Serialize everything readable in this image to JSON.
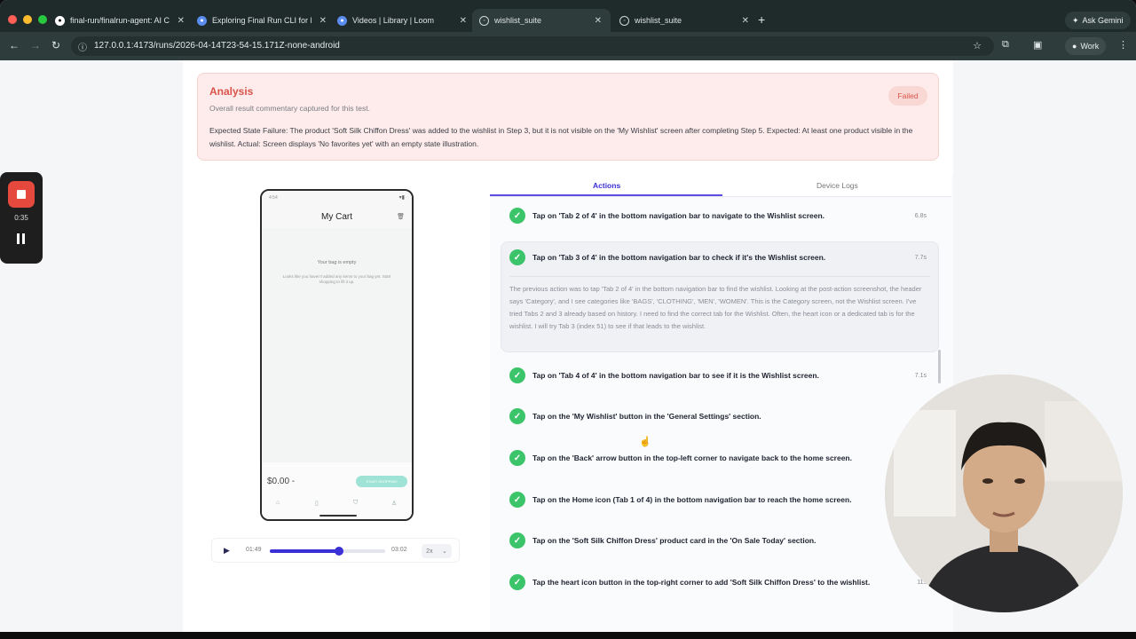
{
  "browser": {
    "tabs": [
      {
        "label": "final-run/finalrun-agent: AI C",
        "icon": "github-icon"
      },
      {
        "label": "Exploring Final Run CLI for E",
        "icon": "chrome-icon"
      },
      {
        "label": "Videos | Library | Loom",
        "icon": "chrome-icon"
      },
      {
        "label": "wishlist_suite",
        "icon": "globe-icon",
        "active": true
      },
      {
        "label": "wishlist_suite",
        "icon": "globe-icon"
      }
    ],
    "ask_gemini": "Ask Gemini",
    "url": "127.0.0.1:4173/runs/2026-04-14T23-54-15.171Z-none-android",
    "profile": "Work",
    "colors": {
      "chrome": "#1f2a2a",
      "toolbar": "#2f3c3c"
    }
  },
  "analysis": {
    "title": "Analysis",
    "subtitle": "Overall result commentary captured for this test.",
    "status": "Failed",
    "body": "Expected State Failure: The product 'Soft Silk Chiffon Dress' was added to the wishlist in Step 3, but it is not visible on the 'My Wishlist' screen after completing Step 5. Expected: At least one product visible in the wishlist. Actual: Screen displays 'No favorites yet' with an empty state illustration.",
    "colors": {
      "accent": "#d9534a",
      "background": "#fdeceb"
    }
  },
  "phone": {
    "status_time": "4:54",
    "title": "My Cart",
    "empty_title": "Your bag is empty",
    "empty_text": "Looks like you haven't added any items to your bag yet. Start shopping to fill it up.",
    "price": "$0.00 -",
    "checkout": "START SHOPPING"
  },
  "player": {
    "current": "01:49",
    "total": "03:02",
    "progress": 0.6,
    "speed": "2x"
  },
  "recorder": {
    "time": "0:35"
  },
  "actions_panel": {
    "tab_actions": "Actions",
    "tab_logs": "Device Logs",
    "accent": "#3b2fd6",
    "steps": [
      {
        "label": "Tap on 'Tab 2 of 4' in the bottom navigation bar to navigate to the Wishlist screen.",
        "duration": "6.8s"
      },
      {
        "label": "Tap on 'Tab 3 of 4' in the bottom navigation bar to check if it's the Wishlist screen.",
        "duration": "7.7s",
        "reasoning": "The previous action was to tap 'Tab 2 of 4' in the bottom navigation bar to find the wishlist. Looking at the post-action screenshot, the header says 'Category', and I see categories like 'BAGS', 'CLOTHING', 'MEN', 'WOMEN'. This is the Category screen, not the Wishlist screen. I've tried Tabs 2 and 3 already based on history. I need to find the correct tab for the Wishlist. Often, the heart icon or a dedicated tab is for the wishlist. I will try Tab 3 (index 51) to see if that leads to the wishlist."
      },
      {
        "label": "Tap on 'Tab 4 of 4' in the bottom navigation bar to see if it is the Wishlist screen.",
        "duration": "7.1s"
      },
      {
        "label": "Tap on the 'My Wishlist' button in the 'General Settings' section.",
        "duration": ""
      },
      {
        "label": "Tap on the 'Back' arrow button in the top-left corner to navigate back to the home screen.",
        "duration": ""
      },
      {
        "label": "Tap on the Home icon (Tab 1 of 4) in the bottom navigation bar to reach the home screen.",
        "duration": ""
      },
      {
        "label": "Tap on the 'Soft Silk Chiffon Dress' product card in the 'On Sale Today' section.",
        "duration": ""
      },
      {
        "label": "Tap the heart icon button in the top-right corner to add 'Soft Silk Chiffon Dress' to the wishlist.",
        "duration": "11s"
      }
    ]
  }
}
